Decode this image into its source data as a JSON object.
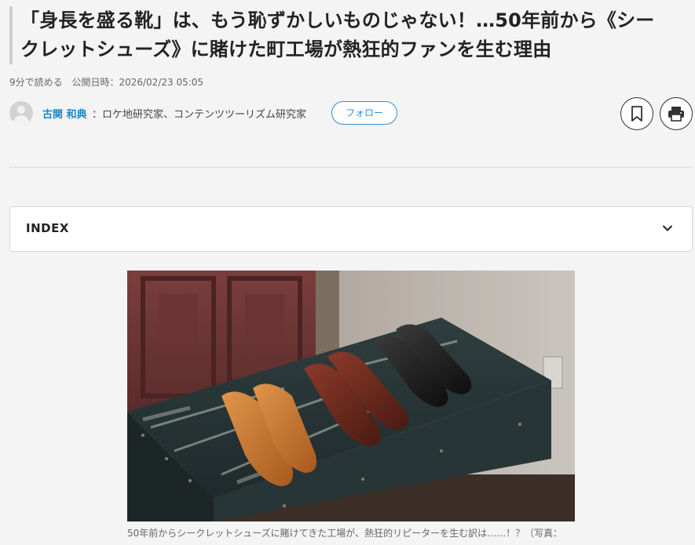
{
  "article": {
    "title_line1": "「身長を盛る靴」は、もう恥ずかしいものじゃない！…50年前から《シー",
    "title_line2": "クレットシューズ》に賭けた町工場が熱狂的ファンを生む理由",
    "read_time": "9分で読める",
    "published": "公開日時：2026/02/23 05:05"
  },
  "author": {
    "name": "古関 和典",
    "title": "：ロケ地研究家、コンテンツツーリズム研究家",
    "follow_label": "フォロー",
    "avatar_icon": "user-avatar-icon"
  },
  "actions": {
    "bookmark_icon": "bookmark-icon",
    "print_icon": "print-icon"
  },
  "index": {
    "label": "INDEX",
    "icon": "chevron-down-icon"
  },
  "figure": {
    "image_description": "shoes-on-trunk-photo",
    "caption": "50年前からシークレットシューズに賭けてきた工場が、熱狂的リピーターを生む訳は……！？（写真："
  },
  "colors": {
    "accent": "#2f8dd0",
    "author_name": "#1a88c9",
    "background": "#f4f4f4"
  }
}
